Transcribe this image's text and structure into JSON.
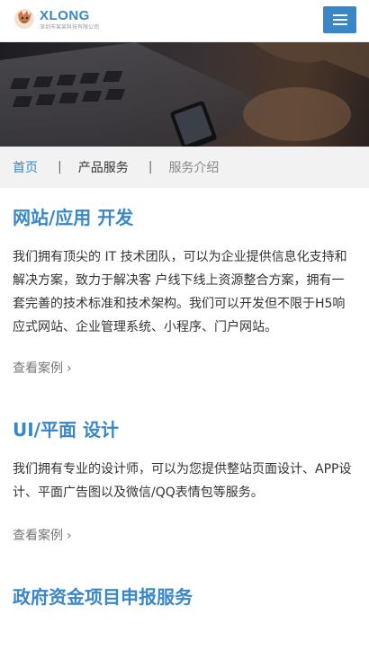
{
  "header": {
    "logo_title": "XLONG",
    "logo_subtitle": "深圳市某某科技有限公司",
    "menu_icon": "hamburger-menu-icon"
  },
  "banner": {
    "description_icon": "laptop-phone-photo"
  },
  "breadcrumb": {
    "home": "首页",
    "separator": "|",
    "category": "产品服务",
    "current": "服务介绍"
  },
  "sections": [
    {
      "title": "网站/应用 开发",
      "body": "我们拥有顶尖的 IT 技术团队，可以为企业提供信息化支持和解决方案，致力于解决客 户线下线上资源整合方案，拥有一套完善的技术标准和技术架构。我们可以开发但不限于H5响应式网站、企业管理系统、小程序、门户网站。",
      "link": "查看案例"
    },
    {
      "title": "UI/平面 设计",
      "body": "我们拥有专业的设计师，可以为您提供整站页面设计、APP设计、平面广告图以及微信/QQ表情包等服务。",
      "link": "查看案例"
    },
    {
      "title": "政府资金项目申报服务"
    }
  ],
  "link_chevron": "›",
  "colors": {
    "accent": "#3a87c7",
    "crumb_bg": "#f2f2f2"
  }
}
